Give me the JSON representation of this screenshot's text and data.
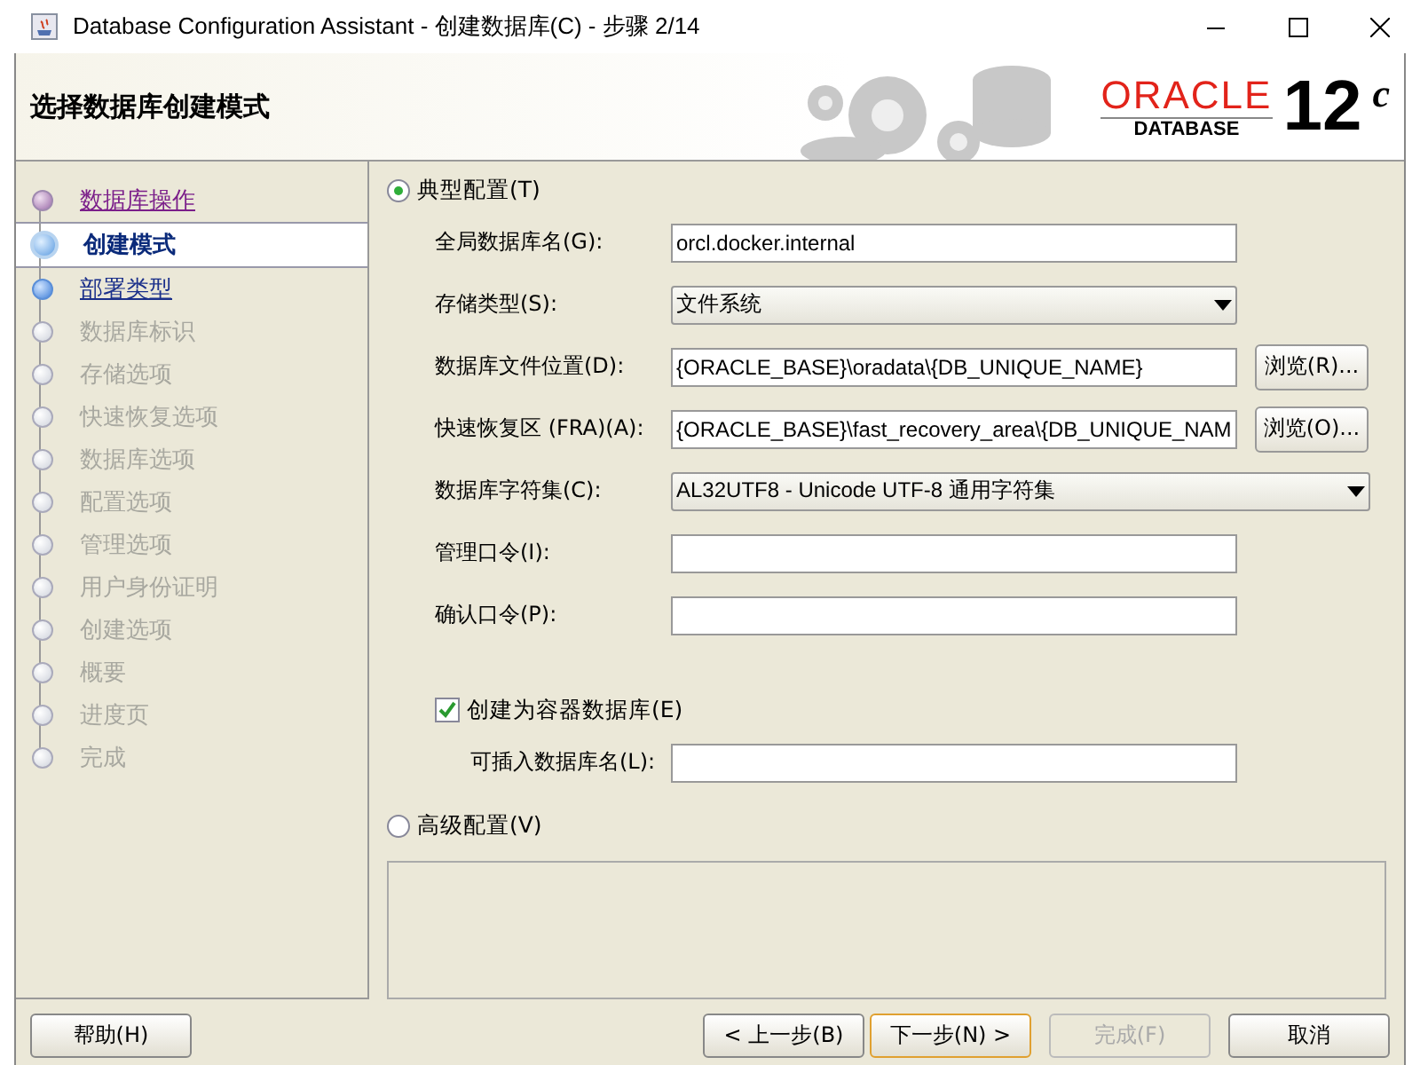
{
  "window": {
    "title": "Database Configuration Assistant - 创建数据库(C) - 步骤 2/14"
  },
  "header": {
    "title": "选择数据库创建模式",
    "logo": {
      "brand": "ORACLE",
      "product": "DATABASE",
      "version": "12",
      "version_suffix": "c"
    }
  },
  "steps": [
    {
      "label": "数据库操作",
      "kind": "visited"
    },
    {
      "label": "创建模式",
      "kind": "current"
    },
    {
      "label": "部署类型",
      "kind": "available"
    },
    {
      "label": "数据库标识",
      "kind": "pending"
    },
    {
      "label": "存储选项",
      "kind": "pending"
    },
    {
      "label": "快速恢复选项",
      "kind": "pending"
    },
    {
      "label": "数据库选项",
      "kind": "pending"
    },
    {
      "label": "配置选项",
      "kind": "pending"
    },
    {
      "label": "管理选项",
      "kind": "pending"
    },
    {
      "label": "用户身份证明",
      "kind": "pending"
    },
    {
      "label": "创建选项",
      "kind": "pending"
    },
    {
      "label": "概要",
      "kind": "pending"
    },
    {
      "label": "进度页",
      "kind": "pending"
    },
    {
      "label": "完成",
      "kind": "pending"
    }
  ],
  "typical": {
    "label": "典型配置(T)",
    "selected": true,
    "fields": [
      {
        "kind": "text",
        "label": "全局数据库名(G):",
        "value": "orcl.docker.internal"
      },
      {
        "kind": "select",
        "label": "存储类型(S):",
        "value": "文件系统"
      },
      {
        "kind": "text",
        "label": "数据库文件位置(D):",
        "value": "{ORACLE_BASE}\\oradata\\{DB_UNIQUE_NAME}",
        "browse": "浏览(R)..."
      },
      {
        "kind": "text",
        "label": "快速恢复区 (FRA)(A):",
        "value": "{ORACLE_BASE}\\fast_recovery_area\\{DB_UNIQUE_NAM",
        "browse": "浏览(O)..."
      },
      {
        "kind": "wideselect",
        "label": "数据库字符集(C):",
        "value": "AL32UTF8 - Unicode UTF-8 通用字符集"
      },
      {
        "kind": "text",
        "label": "管理口令(I):"
      },
      {
        "kind": "text",
        "label": "确认口令(P):"
      }
    ],
    "container": {
      "label": "创建为容器数据库(E)",
      "checked": true,
      "pluggable_label": "可插入数据库名(L):"
    }
  },
  "advanced": {
    "label": "高级配置(V)",
    "selected": false
  },
  "buttons": {
    "help": {
      "label": "帮助(H)",
      "disabled": false
    },
    "back": {
      "label": "< 上一步(B)",
      "disabled": false
    },
    "next": {
      "label": "下一步(N) >",
      "disabled": false
    },
    "finish": {
      "label": "完成(F)",
      "disabled": true
    },
    "cancel": {
      "label": "取消",
      "disabled": false
    }
  }
}
